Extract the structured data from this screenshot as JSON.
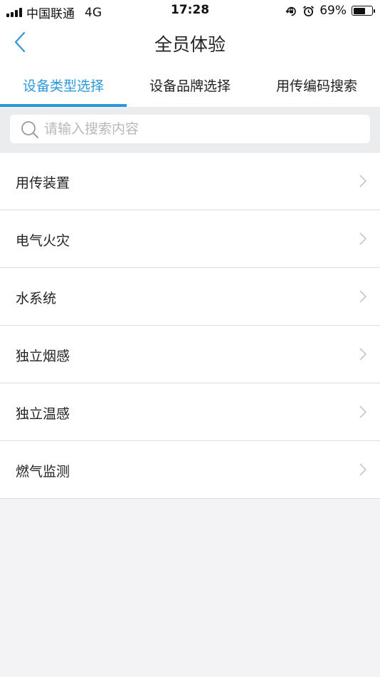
{
  "status": {
    "carrier": "中国联通",
    "network": "4G",
    "time": "17:28",
    "battery_label": "69%",
    "battery_level": 0.69
  },
  "nav": {
    "title": "全员体验",
    "back_icon": "chevron-left-icon"
  },
  "tabs": [
    {
      "label": "设备类型选择",
      "active": true
    },
    {
      "label": "设备品牌选择",
      "active": false
    },
    {
      "label": "用传编码搜索",
      "active": false
    }
  ],
  "search": {
    "placeholder": "请输入搜索内容",
    "value": "",
    "icon": "search-icon"
  },
  "list": {
    "items": [
      {
        "label": "用传装置"
      },
      {
        "label": "电气火灾"
      },
      {
        "label": "水系统"
      },
      {
        "label": "独立烟感"
      },
      {
        "label": "独立温感"
      },
      {
        "label": "燃气监测"
      }
    ]
  },
  "colors": {
    "accent": "#2c98dc",
    "background": "#f3f3f5",
    "search_bg": "#ebecee",
    "divider": "#dedede"
  }
}
